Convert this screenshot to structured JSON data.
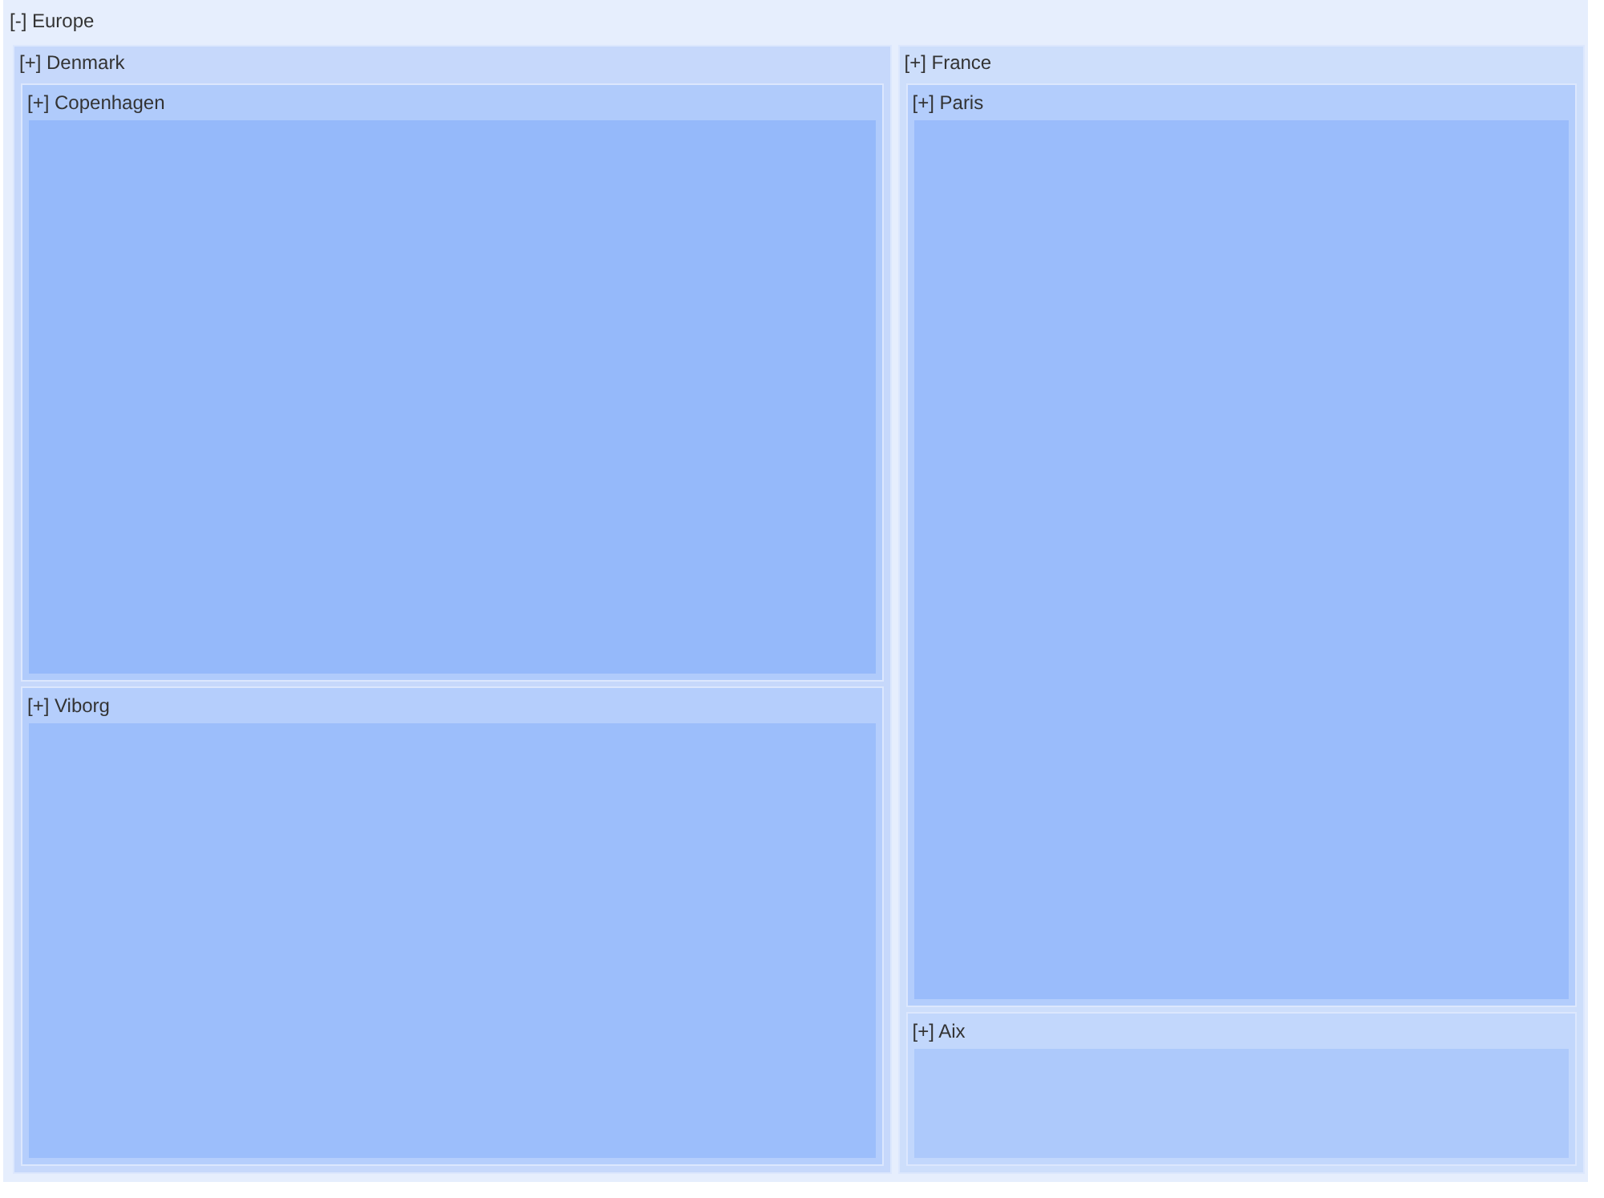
{
  "treemap": {
    "label": "[-] Europe",
    "color": "#e6eefd",
    "children": [
      {
        "label": "[+] Denmark",
        "color": "#c6d8fb",
        "children": [
          {
            "label": "[+] Copenhagen",
            "color": "#95b9fa"
          },
          {
            "label": "[+] Viborg",
            "color": "#9cbefb"
          }
        ]
      },
      {
        "label": "[+] France",
        "color": "#cddefb",
        "children": [
          {
            "label": "[+] Paris",
            "color": "#9abcfb"
          },
          {
            "label": "[+] Aix",
            "color": "#adc9fb"
          }
        ]
      }
    ]
  }
}
